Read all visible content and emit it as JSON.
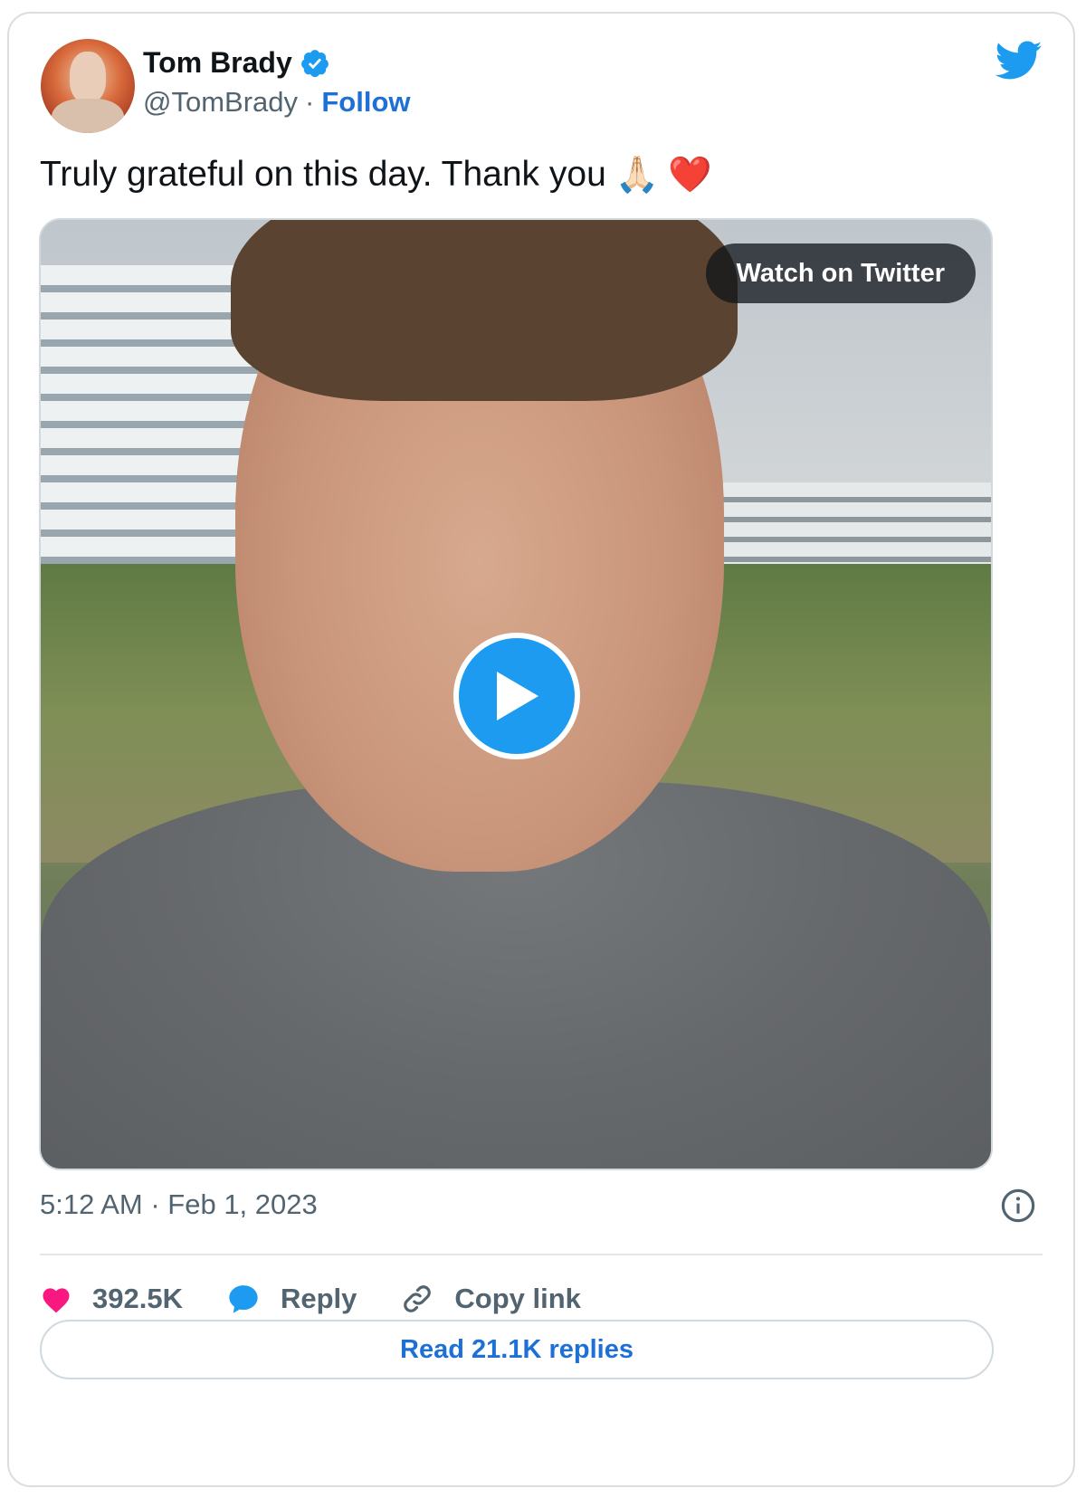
{
  "author": {
    "name": "Tom Brady",
    "handle": "@TomBrady",
    "separator": "·",
    "follow_label": "Follow",
    "verified": true
  },
  "tweet": {
    "text": "Truly grateful on this day. Thank you",
    "emojis": [
      "🙏🏻",
      "❤️"
    ]
  },
  "media": {
    "watch_label": "Watch on Twitter",
    "type": "video"
  },
  "meta": {
    "timestamp": "5:12 AM · Feb 1, 2023"
  },
  "actions": {
    "likes": "392.5K",
    "reply_label": "Reply",
    "copy_label": "Copy link"
  },
  "replies_button": "Read 21.1K replies",
  "colors": {
    "accent": "#1d9bf0",
    "link": "#1d70d6",
    "heart": "#f91880",
    "muted": "#536471"
  }
}
